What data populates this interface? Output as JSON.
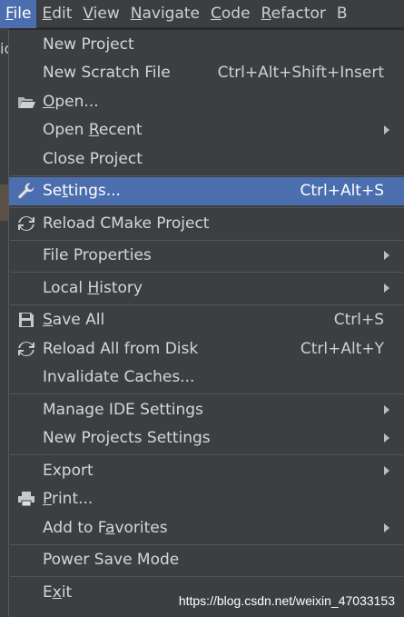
{
  "menubar": {
    "items": [
      {
        "mn": "F",
        "rest": "ile"
      },
      {
        "mn": "E",
        "rest": "dit"
      },
      {
        "mn": "V",
        "rest": "iew"
      },
      {
        "mn": "N",
        "rest": "avigate"
      },
      {
        "mn": "C",
        "rest": "ode"
      },
      {
        "mn": "R",
        "rest": "efactor"
      },
      {
        "mn": "B",
        "rest": ""
      }
    ]
  },
  "background": {
    "left_letters": "ic"
  },
  "menu": {
    "new_project": "New Project",
    "new_scratch": "New Scratch File",
    "new_scratch_shortcut": "Ctrl+Alt+Shift+Insert",
    "open_mn": "O",
    "open_rest": "pen...",
    "open_recent_pre": "Open ",
    "open_recent_mn": "R",
    "open_recent_rest": "ecent",
    "close_project": "Close Project",
    "settings_pre": "Se",
    "settings_mn": "t",
    "settings_rest": "tings...",
    "settings_shortcut": "Ctrl+Alt+S",
    "reload_cmake": "Reload CMake Project",
    "file_properties": "File Properties",
    "local_history_pre": "Local ",
    "local_history_mn": "H",
    "local_history_rest": "istory",
    "save_all_mn": "S",
    "save_all_rest": "ave All",
    "save_all_shortcut": "Ctrl+S",
    "reload_all": "Reload All from Disk",
    "reload_all_shortcut": "Ctrl+Alt+Y",
    "invalidate": "Invalidate Caches...",
    "manage_ide": "Manage IDE Settings",
    "new_projects_settings": "New Projects Settings",
    "export": "Export",
    "print_mn": "P",
    "print_rest": "rint...",
    "favorites_pre": "Add to F",
    "favorites_mn": "a",
    "favorites_rest": "vorites",
    "power_save": "Power Save Mode",
    "exit_pre": "E",
    "exit_mn": "x",
    "exit_rest": "it"
  },
  "watermark": "https://blog.csdn.net/weixin_47033153",
  "colors": {
    "selection": "#4b6eaf",
    "menu_bg": "#3c3f41",
    "separator": "#515658"
  }
}
